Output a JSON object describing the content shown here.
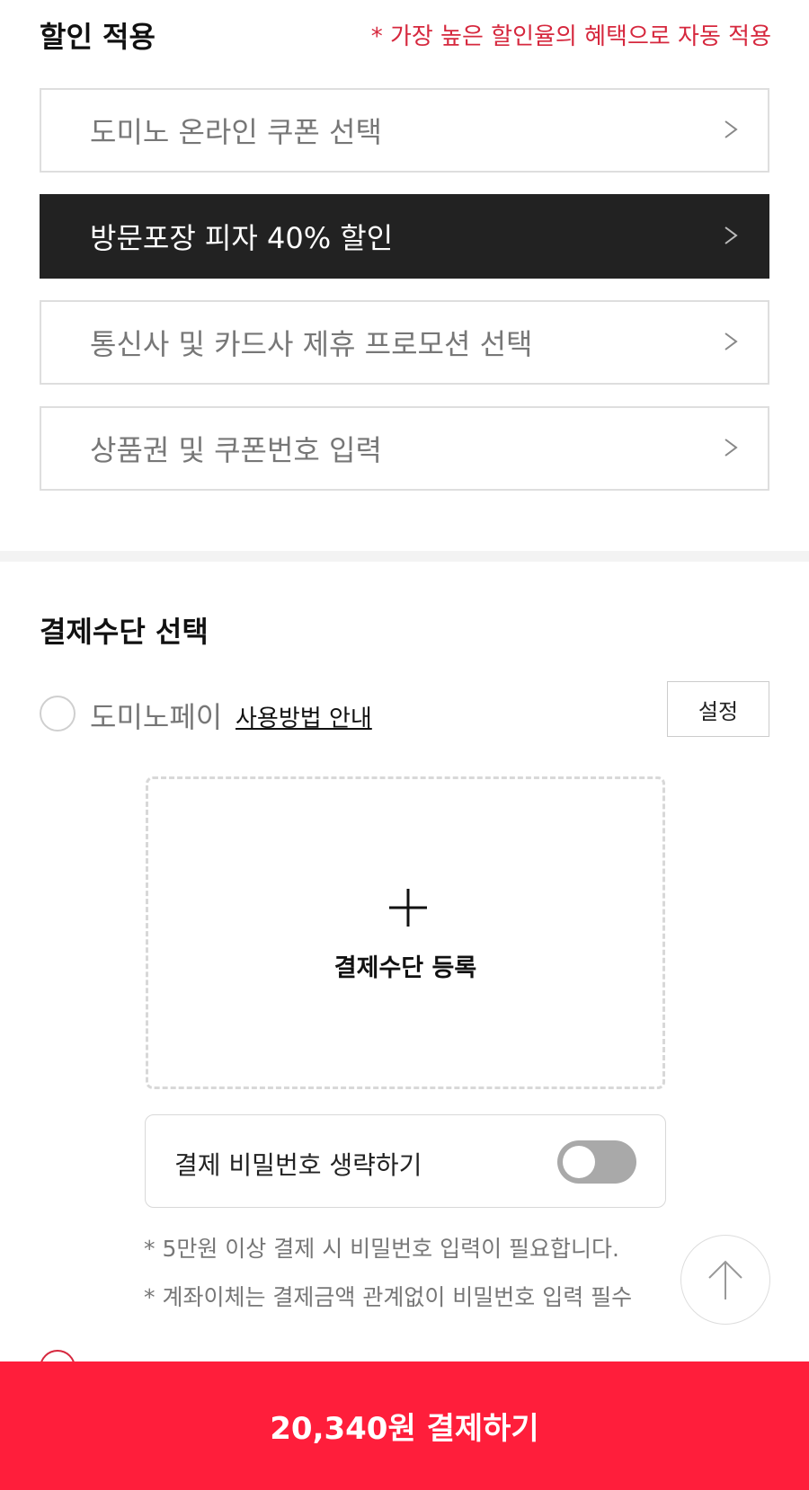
{
  "discount": {
    "title": "할인 적용",
    "notice": "* 가장 높은 할인율의 혜택으로 자동 적용",
    "options": [
      {
        "label": "도미노 온라인 쿠폰 선택",
        "selected": false
      },
      {
        "label": "방문포장 피자 40% 할인",
        "selected": true
      },
      {
        "label": "통신사 및 카드사 제휴 프로모션 선택",
        "selected": false
      },
      {
        "label": "상품권 및 쿠폰번호 입력",
        "selected": false
      }
    ]
  },
  "payment": {
    "title": "결제수단 선택",
    "dominopay": {
      "label": "도미노페이",
      "guide_link": "사용방법 안내",
      "settings_button": "설정"
    },
    "add_method": {
      "label": "결제수단 등록"
    },
    "skip_password": {
      "label": "결제 비밀번호 생략하기",
      "enabled": false
    },
    "notes": [
      "* 5만원 이상 결제 시 비밀번호 입력이 필요합니다.",
      "* 계좌이체는 결제금액 관계없이 비밀번호 입력 필수"
    ]
  },
  "checkout": {
    "button_label": "20,340원 결제하기"
  },
  "colors": {
    "accent": "#ff1e3b",
    "notice_red": "#d6283e",
    "selected_bg": "#222222"
  }
}
